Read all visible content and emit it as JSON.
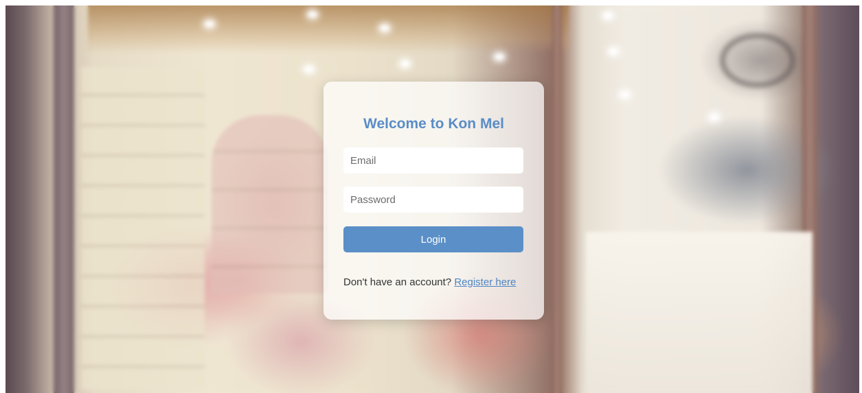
{
  "login": {
    "title": "Welcome to Kon Mel",
    "email_placeholder": "Email",
    "password_placeholder": "Password",
    "login_label": "Login",
    "register_prompt": "Don't have an account?",
    "register_link": "Register here"
  },
  "colors": {
    "accent": "#5b8fc7",
    "title": "#5a8dc6",
    "link": "#4d86c4",
    "card_background": "rgba(255,255,255,0.72)"
  }
}
